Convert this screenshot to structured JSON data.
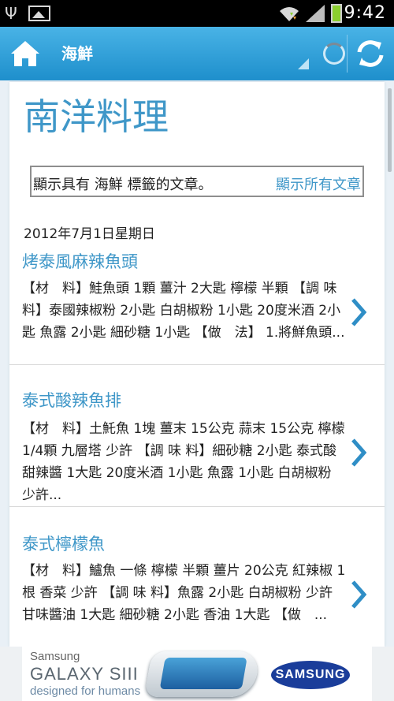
{
  "status_bar": {
    "time": "9:42"
  },
  "action_bar": {
    "title": "海鮮"
  },
  "blog": {
    "title": "南洋料理",
    "tag_filter_text": "顯示具有 海鮮 標籤的文章。",
    "show_all_link": "顯示所有文章",
    "date": "2012年7月1日星期日"
  },
  "posts": [
    {
      "title": "烤泰風麻辣魚頭",
      "excerpt": "【材　料】鮭魚頭 1顆 薑汁 2大匙 檸檬 半顆 【調 味 料】泰國辣椒粉 2小匙 白胡椒粉 1小匙 20度米酒 2小匙 魚露 2小匙 細砂糖 1小匙 【做　法】 1.將鮮魚頭..."
    },
    {
      "title": "泰式酸辣魚排",
      "excerpt": "【材　料】土魠魚 1塊 薑末 15公克 蒜末 15公克 檸檬 1/4顆 九層塔 少許 【調 味 料】細砂糖 2小匙 泰式酸甜辣醬 1大匙 20度米酒 1小匙 魚露 1小匙 白胡椒粉 少許..."
    },
    {
      "title": "泰式檸檬魚",
      "excerpt": "【材　料】鱸魚 一條 檸檬 半顆 薑片 20公克 紅辣椒 1根 香菜 少許 【調 味 料】魚露 2小匙 白胡椒粉 少許 甘味醬油 1大匙 細砂糖 2小匙 香油 1大匙 【做　..."
    }
  ],
  "ad": {
    "brand_line1": "Samsung",
    "brand_line2": "GALAXY SIII",
    "brand_line3": "designed for humans",
    "logo_text": "SAMSUNG"
  },
  "colors": {
    "accent": "#3f97c8",
    "action_bar_top": "#49b3e6",
    "action_bar_bottom": "#1e8fcc"
  },
  "icons": [
    "usb-icon",
    "image-notification-icon",
    "wifi-icon",
    "signal-icon",
    "battery-icon",
    "home-icon",
    "loading-spinner-icon",
    "refresh-icon",
    "chevron-right-icon"
  ]
}
